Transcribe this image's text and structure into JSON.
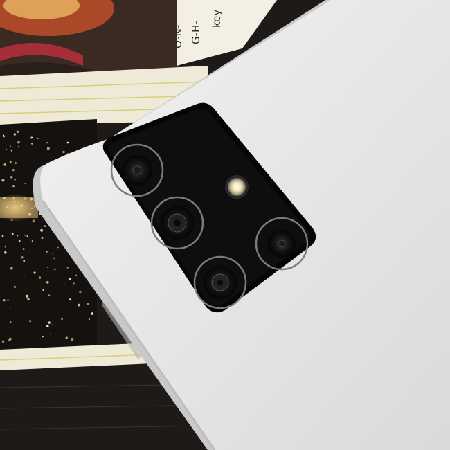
{
  "image": {
    "subject": "smartphone-back-camera-module",
    "background_card_text_1": "O-N-",
    "background_card_text_2": "G-H-",
    "background_card_text_3": "key",
    "colors": {
      "phone_body": "#e6e6e6",
      "phone_edge": "#cfcfcf",
      "camera_bump": "#0b0b0b",
      "lens_ring": "#8a8a8a",
      "background_dark": "#2a2420",
      "card_paper": "#efe9d7",
      "flash_core": "#fff8d6"
    }
  }
}
